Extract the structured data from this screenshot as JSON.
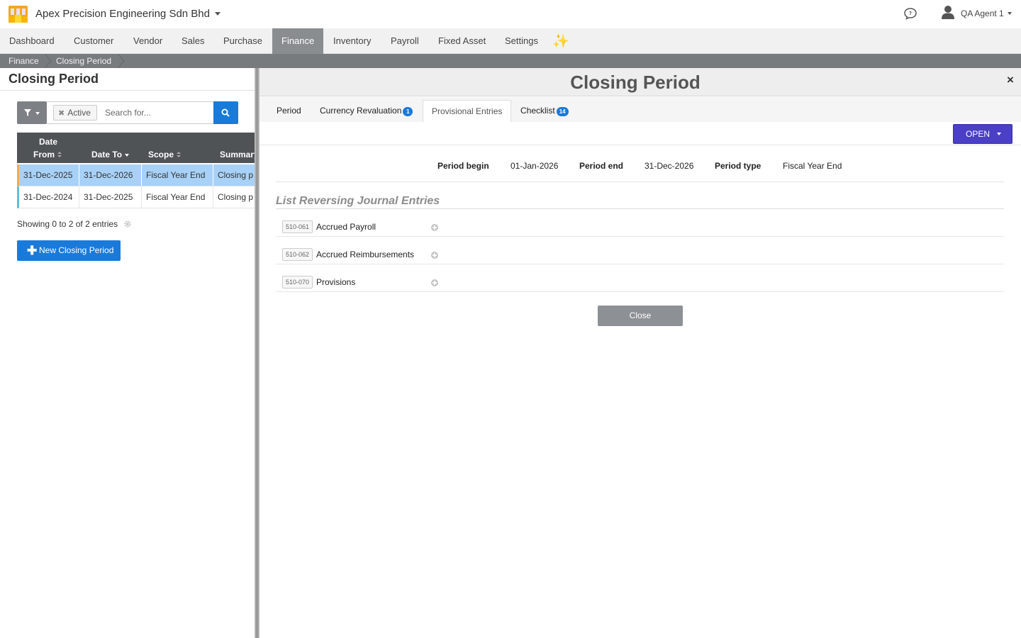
{
  "header": {
    "company_name": "Apex Precision Engineering Sdn Bhd",
    "user_name": "QA Agent 1",
    "brand_color": "#f5a623"
  },
  "nav": {
    "items": [
      {
        "label": "Dashboard"
      },
      {
        "label": "Customer"
      },
      {
        "label": "Vendor"
      },
      {
        "label": "Sales"
      },
      {
        "label": "Purchase"
      },
      {
        "label": "Finance",
        "active": true
      },
      {
        "label": "Inventory"
      },
      {
        "label": "Payroll"
      },
      {
        "label": "Fixed Asset"
      },
      {
        "label": "Settings"
      }
    ],
    "sparkle_icon": "sparkles-icon"
  },
  "breadcrumb": [
    "Finance",
    "Closing Period"
  ],
  "left": {
    "title": "Closing Period",
    "filter_chip": "Active",
    "search_placeholder": "Search for...",
    "columns": [
      {
        "label_line1": "Date",
        "label_line2": "From"
      },
      {
        "label": "Date To"
      },
      {
        "label": "Scope"
      },
      {
        "label": "Summary"
      }
    ],
    "rows": [
      {
        "date_from": "31-Dec-2025",
        "date_to": "31-Dec-2026",
        "scope": "Fiscal Year End",
        "summary": "Closing p",
        "selected": true
      },
      {
        "date_from": "31-Dec-2024",
        "date_to": "31-Dec-2025",
        "scope": "Fiscal Year End",
        "summary": "Closing p",
        "selected": false
      }
    ],
    "showing_text": "Showing 0 to 2 of 2 entries",
    "new_button": "New Closing Period"
  },
  "detail": {
    "title": "Closing Period",
    "close_x": "×",
    "tabs": [
      {
        "label": "Period"
      },
      {
        "label": "Currency Revaluation",
        "badge": "1"
      },
      {
        "label": "Provisional Entries",
        "active": true
      },
      {
        "label": "Checklist",
        "badge": "14"
      }
    ],
    "status_button": "OPEN",
    "status_color": "#4a3fc5",
    "period": {
      "begin_label": "Period begin",
      "begin_value": "01-Jan-2026",
      "end_label": "Period end",
      "end_value": "31-Dec-2026",
      "type_label": "Period type",
      "type_value": "Fiscal Year End"
    },
    "section_title": "List Reversing Journal Entries",
    "entries": [
      {
        "code": "510-061",
        "name": "Accrued Payroll"
      },
      {
        "code": "510-062",
        "name": "Accrued Reimbursements"
      },
      {
        "code": "510-070",
        "name": "Provisions"
      }
    ],
    "close_button": "Close"
  }
}
